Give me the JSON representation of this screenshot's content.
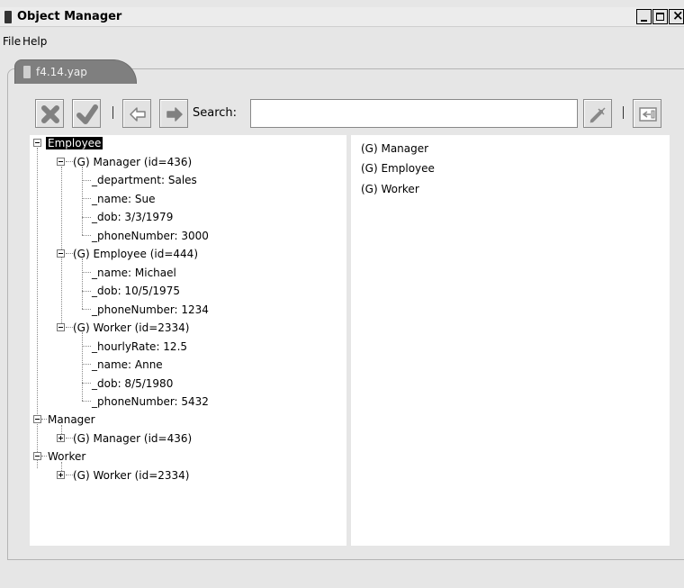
{
  "window": {
    "title": "Object Manager"
  },
  "menu": {
    "items": [
      "File",
      "Help"
    ]
  },
  "tab": {
    "label": "f4.14.yap"
  },
  "toolbar": {
    "search_label": "Search:",
    "search_value": ""
  },
  "tree": {
    "rows": [
      "Employee",
      "(G) Manager (id=436)",
      "_department: Sales",
      "_name: Sue",
      "_dob: 3/3/1979",
      "_phoneNumber: 3000",
      "(G) Employee (id=444)",
      "_name: Michael",
      "_dob: 10/5/1975",
      "_phoneNumber: 1234",
      "(G) Worker (id=2334)",
      "_hourlyRate: 12.5",
      "_name: Anne",
      "_dob: 8/5/1980",
      "_phoneNumber: 5432",
      "Manager",
      "(G) Manager (id=436)",
      "Worker",
      "(G) Worker (id=2334)"
    ]
  },
  "class_list": {
    "items": [
      "(G) Manager",
      "(G) Employee",
      "(G) Worker"
    ]
  },
  "colors": {
    "selection": "#000000",
    "tab": "#7f7f7f",
    "background": "#e6e6e6"
  }
}
